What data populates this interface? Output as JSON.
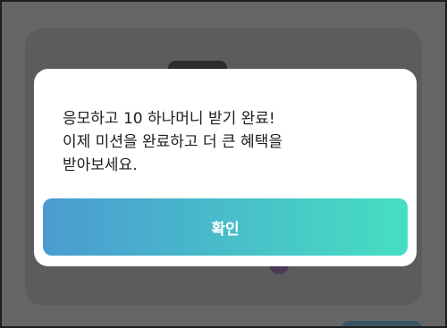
{
  "dialog": {
    "message_lines": [
      "응모하고 10 하나머니 받기 완료!",
      "이제 미션을 완료하고 더 큰 혜택을",
      "받아보세요."
    ],
    "confirm_label": "확인"
  },
  "colors": {
    "button_gradient_start": "#4a9bd0",
    "button_gradient_end": "#46dfc3",
    "overlay": "#666666"
  }
}
